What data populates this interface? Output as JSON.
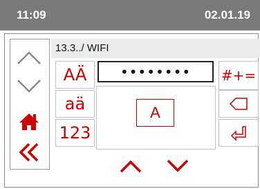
{
  "status_bar": {
    "time": "11:09",
    "date": "02.01.19"
  },
  "breadcrumb": "13.3../ WIFI",
  "password_field": {
    "value": "••••••••"
  },
  "keyboard": {
    "uppercase_label": "AÄ",
    "lowercase_label": "aä",
    "numbers_label": "123",
    "symbols_label": "#+=",
    "current_char": "A"
  },
  "icons": {
    "nav_up": "chevron-up-icon",
    "nav_down": "chevron-down-icon",
    "home": "home-icon",
    "back": "double-chevron-left-icon",
    "backspace": "backspace-icon",
    "enter": "enter-icon",
    "char_prev": "chevron-up-icon",
    "char_next": "chevron-down-icon"
  },
  "colors": {
    "accent": "#cc0000",
    "status_bar": "#7a7a7a",
    "nav_gray": "#8a8a8a"
  }
}
